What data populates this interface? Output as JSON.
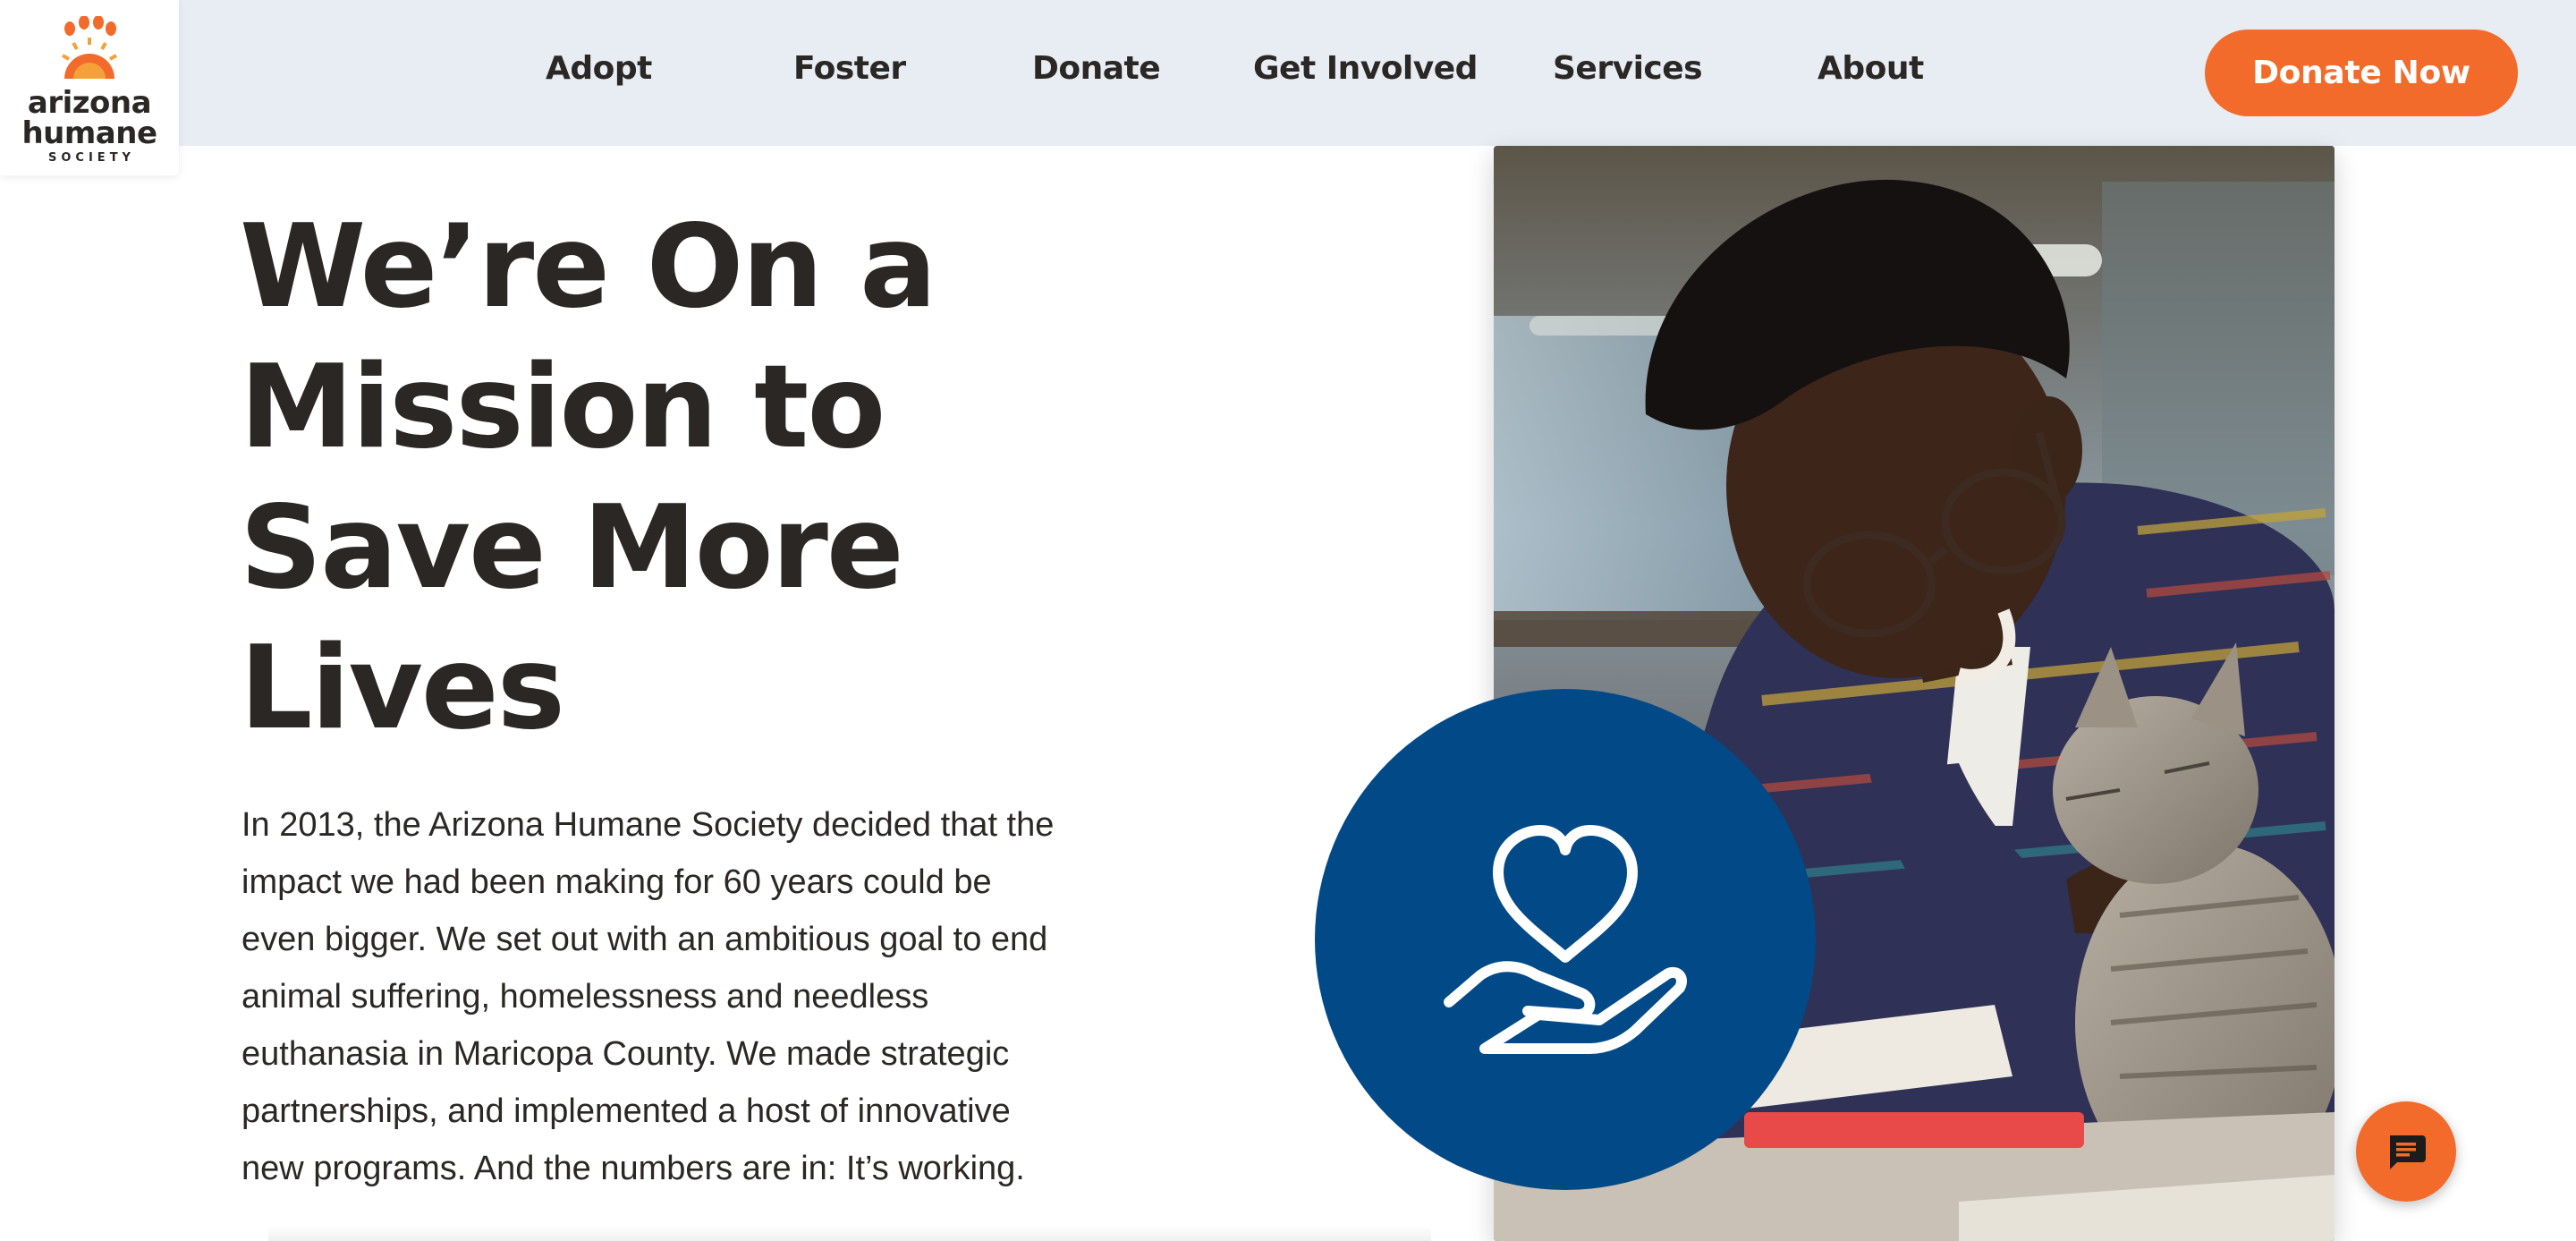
{
  "logo": {
    "line1": "arizona",
    "line2": "humane",
    "line3": "SOCIETY"
  },
  "nav": {
    "items": [
      {
        "label": "Adopt"
      },
      {
        "label": "Foster"
      },
      {
        "label": "Donate"
      },
      {
        "label": "Get Involved"
      },
      {
        "label": "Services"
      },
      {
        "label": "About"
      }
    ],
    "cta_label": "Donate Now"
  },
  "hero": {
    "title_lines": [
      "We’re On a",
      "Mission to",
      "Save More",
      "Lives"
    ],
    "body_lines": [
      "In 2013, the Arizona Humane Society decided that the",
      "impact we had been making for 60 years could be",
      "even bigger. We set out with an ambitious goal to end",
      "animal suffering, homelessness and needless",
      "euthanasia in Maricopa County. We made strategic",
      "partnerships, and implemented a host of innovative",
      "new programs. And the numbers are in: It’s working."
    ]
  },
  "icons": {
    "logo": "paw-sun-icon",
    "feature": "heart-in-hand-icon",
    "chat": "chat-bubble-icon"
  },
  "colors": {
    "brand_orange": "#f26b2b",
    "brand_blue": "#024a87",
    "nav_bg": "#e8edf3",
    "text": "#2a2725"
  }
}
